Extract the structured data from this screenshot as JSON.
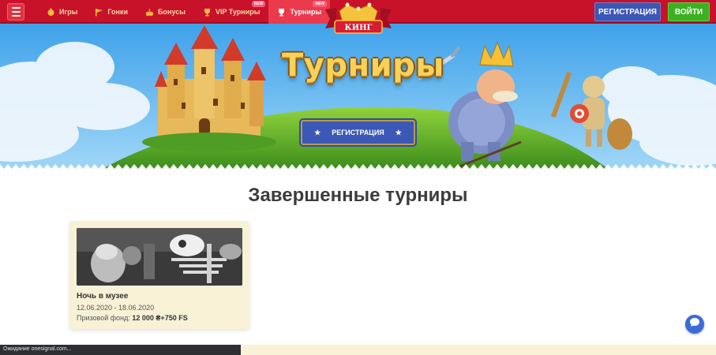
{
  "nav": {
    "items": [
      {
        "label": "Игры",
        "icon": "games-icon",
        "active": false,
        "badge": ""
      },
      {
        "label": "Гонки",
        "icon": "flag-icon",
        "active": false,
        "badge": ""
      },
      {
        "label": "Бонусы",
        "icon": "bonus-icon",
        "active": false,
        "badge": ""
      },
      {
        "label": "VIP Турниры",
        "icon": "trophy-icon",
        "active": false,
        "badge": "NEW"
      },
      {
        "label": "Турниры",
        "icon": "trophy-icon",
        "active": true,
        "badge": "NEW"
      }
    ],
    "logo_text": "КИНГ",
    "register_label": "РЕГИСТРАЦИЯ",
    "login_label": "ВОЙТИ"
  },
  "hero": {
    "title": "Турниры",
    "cta_label": "РЕГИСТРАЦИЯ",
    "cta_star": "★"
  },
  "section": {
    "title": "Завершенные турниры"
  },
  "tournaments": [
    {
      "name": "Ночь в музее",
      "dates": "12.06.2020 - 18.06.2020",
      "prize_label": "Призовой фонд:",
      "prize_value": "12 000 ₴+750 FS"
    }
  ],
  "status_bar": {
    "text": "Ожидание onesignal.com..."
  },
  "colors": {
    "topbar": "#c8122a",
    "active_tab": "#ea3a4c",
    "register": "#3c56b5",
    "login": "#3cb022",
    "card_bg": "#f8f1d6"
  }
}
